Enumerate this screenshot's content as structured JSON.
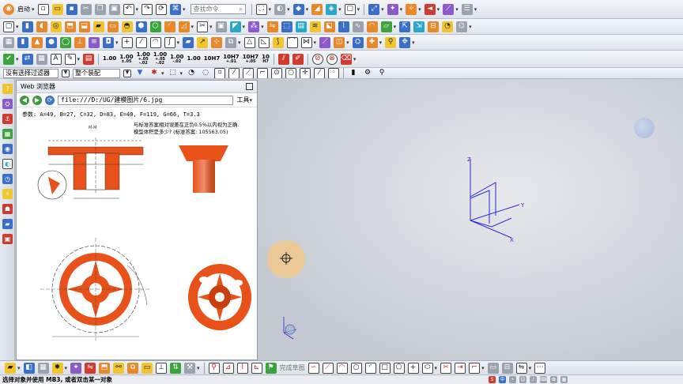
{
  "toolbar1": {
    "start_label": "启动",
    "search_placeholder": "查找命令"
  },
  "toolbar4": {
    "dims": [
      {
        "top": "1.00",
        "bottom": ""
      },
      {
        "top": "1.00",
        "bottom": "±.05"
      },
      {
        "top": "1.00",
        "bottom": "+.05\n-.02"
      },
      {
        "top": "1.00",
        "bottom": "+.05\n-.02"
      },
      {
        "top": "1.00",
        "bottom": "-.02"
      },
      {
        "top": "1.00",
        "bottom": ""
      },
      {
        "top": "10H7",
        "bottom": ""
      },
      {
        "top": "10H7",
        "bottom": "+.01"
      },
      {
        "top": "10H7",
        "bottom": "+.05"
      },
      {
        "top": "10",
        "bottom": "H7"
      }
    ]
  },
  "filter_bar": {
    "selection_filter": "没有选择过滤器",
    "assembly_scope": "整个装配"
  },
  "browser": {
    "title": "Web 浏览器",
    "url": "file:///D:/UG/建模图片/6.jpg",
    "tools_label": "工具",
    "params": "参数: A=49, B=27, C=32, D=83, E=40, F=119, G=66, T=3.3",
    "question_line1": "与标准答案相对误差在正负0.5%以内视为正确.",
    "question_line2": "模型体积是多少? (标准答案: 105563.05)",
    "section_label": "M-M"
  },
  "viewport": {
    "axis_z": "Z",
    "axis_y": "Y",
    "axis_x": "X"
  },
  "bottom_toolbar": {
    "sketch_label": "完成草图"
  },
  "status": {
    "prompt": "选择对象并使用 MB3, 或者双击某一对象"
  },
  "colors": {
    "part_orange": "#e8521a",
    "axis_blue": "#2b2bd1",
    "accent_ring": "#f0c88c"
  }
}
